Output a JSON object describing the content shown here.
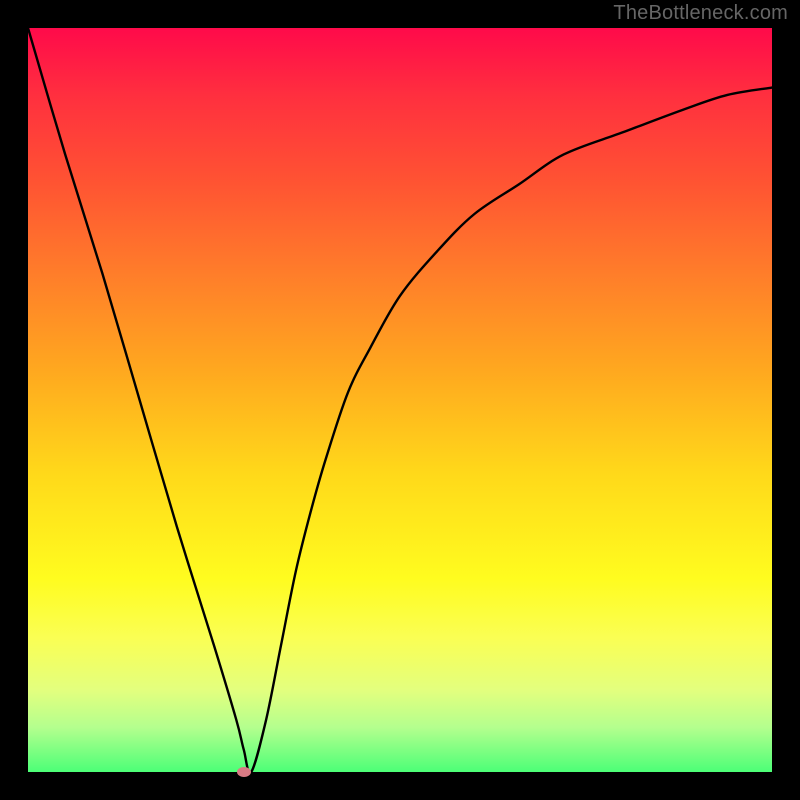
{
  "watermark": "TheBottleneck.com",
  "chart_data": {
    "type": "line",
    "title": "",
    "xlabel": "",
    "ylabel": "",
    "xlim": [
      0,
      100
    ],
    "ylim": [
      0,
      100
    ],
    "grid": false,
    "series": [
      {
        "name": "curve",
        "x": [
          0,
          5,
          10,
          15,
          20,
          25,
          28,
          29,
          30,
          32,
          34,
          36,
          38,
          40,
          43,
          46,
          50,
          55,
          60,
          66,
          72,
          80,
          88,
          94,
          100
        ],
        "y": [
          100,
          83,
          67,
          50,
          33,
          17,
          7,
          3,
          0,
          7,
          17,
          27,
          35,
          42,
          51,
          57,
          64,
          70,
          75,
          79,
          83,
          86,
          89,
          91,
          92
        ]
      }
    ],
    "marker": {
      "x": 29,
      "y": 0
    },
    "background_gradient": {
      "top": "#ff0a4a",
      "mid": "#ffd91a",
      "bottom": "#4cff77"
    },
    "frame_color": "#000000"
  }
}
